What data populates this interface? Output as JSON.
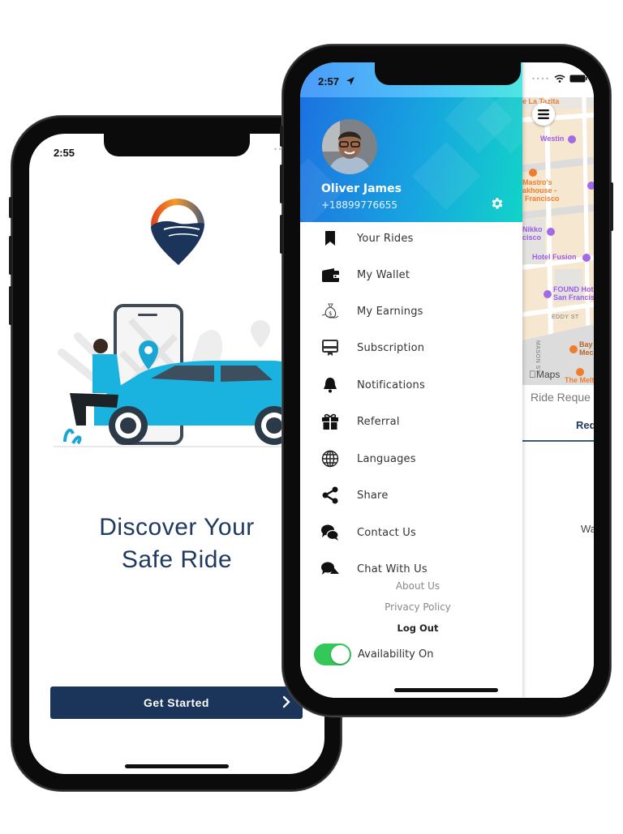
{
  "left_phone": {
    "status_time": "2:55",
    "headline_line1": "Discover Your",
    "headline_line2": "Safe Ride",
    "get_started_label": "Get Started",
    "brand_color": "#1b3459"
  },
  "right_phone": {
    "status_time": "2:57",
    "drawer": {
      "user_name": "Oliver James",
      "user_phone": "+18899776655",
      "menu_items": [
        {
          "label": "Your Rides",
          "icon": "bookmark-icon"
        },
        {
          "label": "My Wallet",
          "icon": "wallet-icon"
        },
        {
          "label": "My Earnings",
          "icon": "money-bag-icon"
        },
        {
          "label": "Subscription",
          "icon": "certificate-icon"
        },
        {
          "label": "Notifications",
          "icon": "bell-icon"
        },
        {
          "label": "Referral",
          "icon": "gift-icon"
        },
        {
          "label": "Languages",
          "icon": "globe-icon"
        },
        {
          "label": "Share",
          "icon": "share-icon"
        },
        {
          "label": "Contact Us",
          "icon": "chat-bubbles-icon"
        },
        {
          "label": "Chat With Us",
          "icon": "chat-icon"
        }
      ],
      "footer_links": {
        "about": "About Us",
        "privacy": "Privacy Policy",
        "logout": "Log Out"
      },
      "availability_label": "Availability On",
      "availability_on": true,
      "toggle_color": "#34c759"
    },
    "map": {
      "labels": {
        "la_tazita": "e La Tazita",
        "westin": "Westin",
        "mastros_1": "Mastro's",
        "mastros_2": "akhouse -",
        "mastros_3": "Francisco",
        "nikko_1": "Nikko",
        "nikko_2": "cisco",
        "hotel_fusion": "Hotel Fusion",
        "found_1": "FOUND Hot",
        "found_2": "San Francis",
        "eddy": "EDDY ST",
        "mason": "MASON ST",
        "bay_1": "Bay",
        "bay_2": "Mec",
        "melt": "The Melt"
      },
      "maps_attribution": "Maps",
      "ride_requests_title": "Ride Reque",
      "requests_tab": "Req",
      "waiting_text": "Wa"
    }
  }
}
